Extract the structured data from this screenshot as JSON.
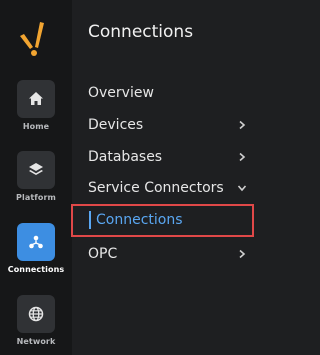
{
  "rail": {
    "items": [
      {
        "label": "Home",
        "icon": "home-icon"
      },
      {
        "label": "Platform",
        "icon": "layers-icon"
      },
      {
        "label": "Connections",
        "icon": "connections-icon",
        "active": true
      },
      {
        "label": "Network",
        "icon": "globe-icon"
      }
    ]
  },
  "panel": {
    "title": "Connections",
    "menu": [
      {
        "label": "Overview"
      },
      {
        "label": "Devices",
        "chevron": "chevron-right-icon"
      },
      {
        "label": "Databases",
        "chevron": "chevron-right-icon"
      },
      {
        "label": "Service Connectors",
        "chevron": "chevron-down-icon",
        "expanded": true
      },
      {
        "label": "OPC",
        "chevron": "chevron-right-icon"
      }
    ],
    "submenu": {
      "label": "Connections",
      "selected": true
    }
  },
  "colors": {
    "accent": "#3d8ee2",
    "selected_text": "#5aa7f2",
    "highlight_border": "#e04848",
    "logo": "#f2a531"
  }
}
